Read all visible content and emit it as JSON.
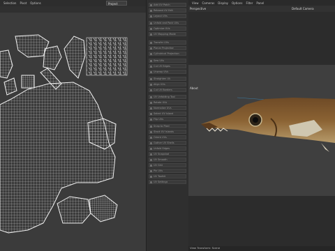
{
  "uv_editor": {
    "menu": [
      "Selection",
      "Pivot",
      "Options"
    ],
    "dropdown": "Project"
  },
  "side_panel": {
    "items": [
      "Add UV Patch",
      "Relaxed UV Edit",
      "Layout UVs",
      "Unfold and Pack UVs",
      "Optimize UVs",
      "UV Mapping Mode",
      "Transfer UVs",
      "Planar Projection",
      "Cylindrical Projection",
      "Sew UVs",
      "Cut UV Edges",
      "Unwrap UVs",
      "Straighten UV",
      "Align UVs",
      "Cut UV Borders",
      "UV Unfolding Tool",
      "Rotate UVs",
      "Normalize UVs",
      "Select UV Island",
      "Flip UVs",
      "Snap to Pixel",
      "Stack UV Islands",
      "Orient UVs",
      "Gather UV Shells",
      "Unfold Edges",
      "UV Snapshot",
      "UV Smooth",
      "UV Grid",
      "Pin UVs",
      "UV Toolkit",
      "UV Settings"
    ]
  },
  "viewport": {
    "menu": [
      "View",
      "Cameras",
      "Display",
      "Options",
      "Filter",
      "Panel"
    ],
    "perspective_label": "Perspective",
    "camera_label": "Default Camera",
    "overlay_label": "About",
    "status_text": "View Transform: Scene"
  }
}
